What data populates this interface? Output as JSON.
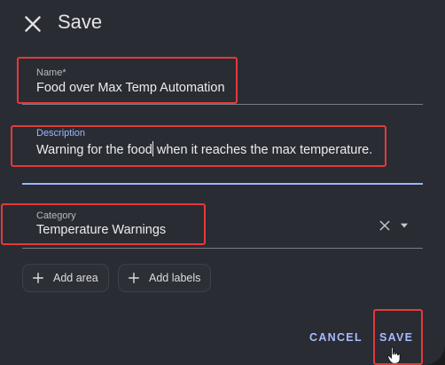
{
  "dialog": {
    "title": "Save",
    "close_icon": "close-icon"
  },
  "form": {
    "name": {
      "label": "Name*",
      "value": "Food over Max Temp Automation"
    },
    "description": {
      "label": "Description",
      "value_before_caret": "Warning for the food",
      "value_after_caret": " when it reaches the max temperature."
    },
    "category": {
      "label": "Category",
      "value": "Temperature Warnings",
      "clear_icon": "clear-icon",
      "dropdown_icon": "dropdown-arrow-icon"
    }
  },
  "chips": [
    {
      "label": "Add area",
      "icon": "plus-icon"
    },
    {
      "label": "Add labels",
      "icon": "plus-icon"
    }
  ],
  "actions": {
    "cancel_label": "CANCEL",
    "save_label": "SAVE"
  },
  "colors": {
    "accent": "#9cb6ff",
    "highlight": "#e43a3a",
    "surface": "#2a2c33"
  }
}
